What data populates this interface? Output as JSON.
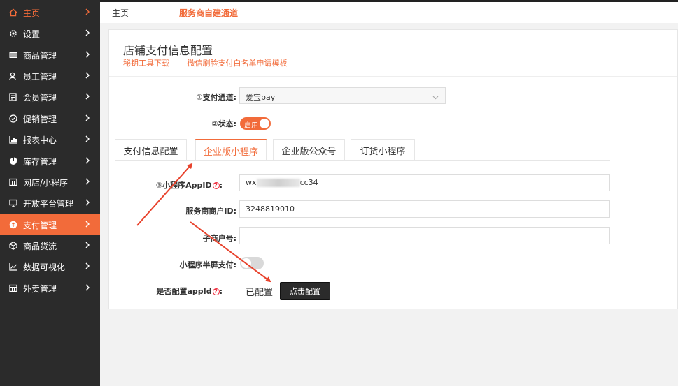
{
  "sidebar": {
    "items": [
      {
        "label": "主页",
        "icon": "home-icon"
      },
      {
        "label": "设置",
        "icon": "gear-icon"
      },
      {
        "label": "商品管理",
        "icon": "barcode-icon"
      },
      {
        "label": "员工管理",
        "icon": "staff-icon"
      },
      {
        "label": "会员管理",
        "icon": "member-card-icon"
      },
      {
        "label": "促销管理",
        "icon": "check-circle-icon"
      },
      {
        "label": "报表中心",
        "icon": "bar-chart-icon"
      },
      {
        "label": "库存管理",
        "icon": "pie-chart-icon"
      },
      {
        "label": "网店/小程序",
        "icon": "store-icon"
      },
      {
        "label": "开放平台管理",
        "icon": "monitor-icon"
      },
      {
        "label": "支付管理",
        "icon": "payment-icon"
      },
      {
        "label": "商品货流",
        "icon": "cube-icon"
      },
      {
        "label": "数据可视化",
        "icon": "line-chart-icon"
      },
      {
        "label": "外卖管理",
        "icon": "store-icon"
      }
    ],
    "active_index": 10
  },
  "breadcrumb": {
    "home": "主页",
    "link": "服务商自建通道"
  },
  "panel": {
    "title": "店铺支付信息配置",
    "links": [
      "秘钥工具下载",
      "微信刷脸支付白名单申请模板"
    ]
  },
  "form": {
    "channel_label": "①支付通道:",
    "channel_value": "爱宝pay",
    "status_label": "②状态:",
    "status_toggle_text": "启用",
    "tabs": [
      "支付信息配置",
      "企业版小程序",
      "企业版公众号",
      "订货小程序"
    ],
    "active_tab": 1,
    "appid_label": "③小程序AppID",
    "appid_prefix": "wx",
    "appid_suffix": "cc34",
    "merchant_id_label": "服务商商户ID:",
    "merchant_id_value": "3248819010",
    "sub_merchant_label": "子商户号:",
    "sub_merchant_value": "",
    "halfscreen_label": "小程序半屏支付:",
    "configured_label": "是否配置appId",
    "configured_value": "已配置",
    "config_button": "点击配置"
  },
  "colors": {
    "accent": "#f26b3a",
    "sidebar_bg": "#2b2b2b",
    "arrow": "#e8432d"
  }
}
